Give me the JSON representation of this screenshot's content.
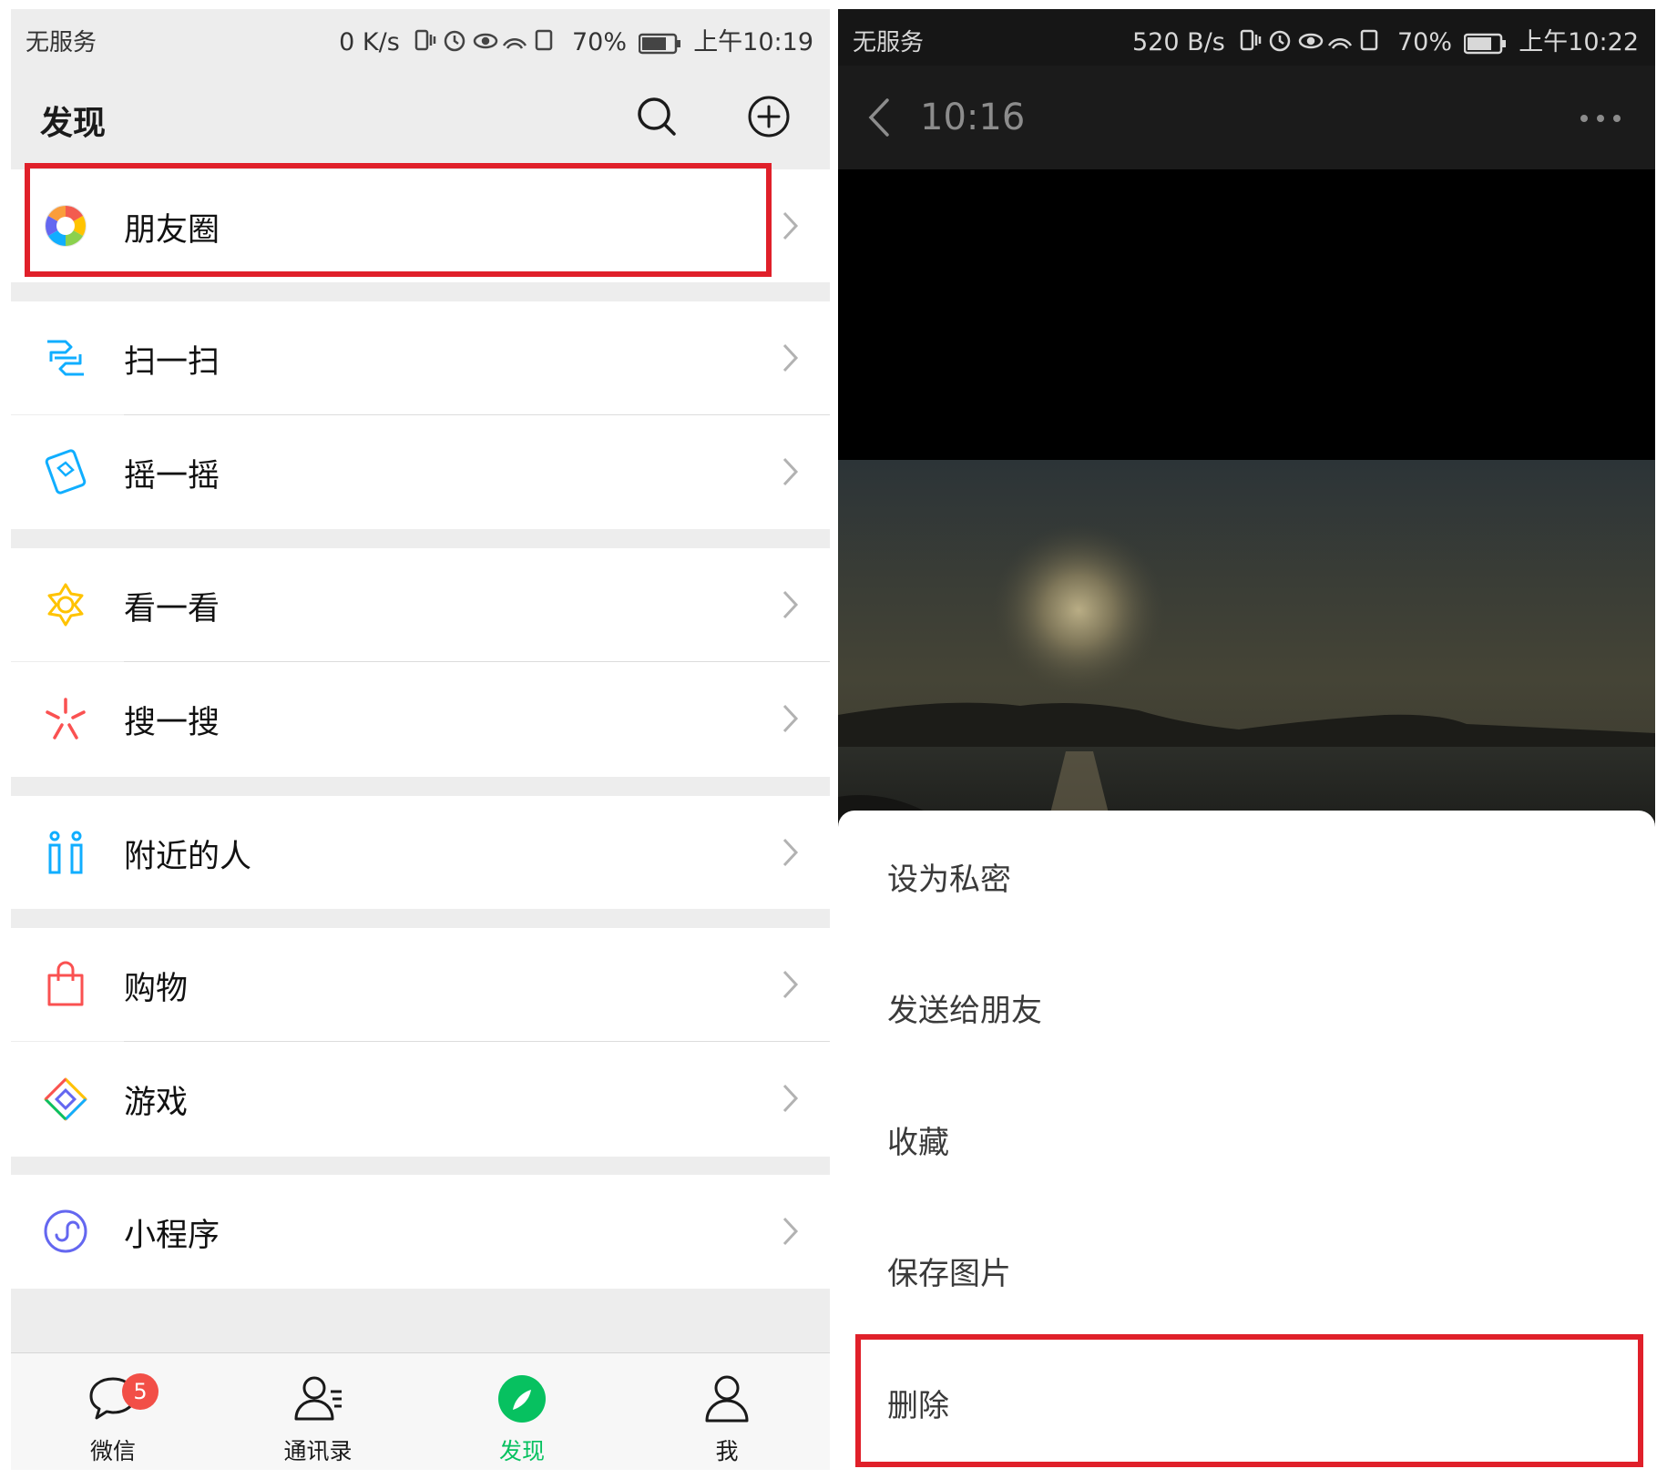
{
  "left": {
    "status": {
      "carrier": "无服务",
      "speed": "0 K/s",
      "battery": "70%",
      "time": "上午10:19"
    },
    "title": "发现",
    "menu": [
      {
        "label": "朋友圈",
        "icon": "moments-icon"
      },
      {
        "label": "扫一扫",
        "icon": "scan-icon"
      },
      {
        "label": "摇一摇",
        "icon": "shake-icon"
      },
      {
        "label": "看一看",
        "icon": "top-stories-icon"
      },
      {
        "label": "搜一搜",
        "icon": "search-sparkle-icon"
      },
      {
        "label": "附近的人",
        "icon": "people-nearby-icon"
      },
      {
        "label": "购物",
        "icon": "shopping-bag-icon"
      },
      {
        "label": "游戏",
        "icon": "games-icon"
      },
      {
        "label": "小程序",
        "icon": "mini-programs-icon"
      }
    ],
    "tabs": [
      {
        "label": "微信",
        "badge": "5"
      },
      {
        "label": "通讯录"
      },
      {
        "label": "发现"
      },
      {
        "label": "我"
      }
    ]
  },
  "right": {
    "status": {
      "carrier": "无服务",
      "speed": "520 B/s",
      "battery": "70%",
      "time": "上午10:22"
    },
    "header_time": "10:16",
    "sheet": [
      "设为私密",
      "发送给朋友",
      "收藏",
      "保存图片",
      "删除"
    ]
  },
  "colors": {
    "highlight": "#e0202a",
    "wechat_green": "#07c160",
    "badge": "#f24f47"
  }
}
